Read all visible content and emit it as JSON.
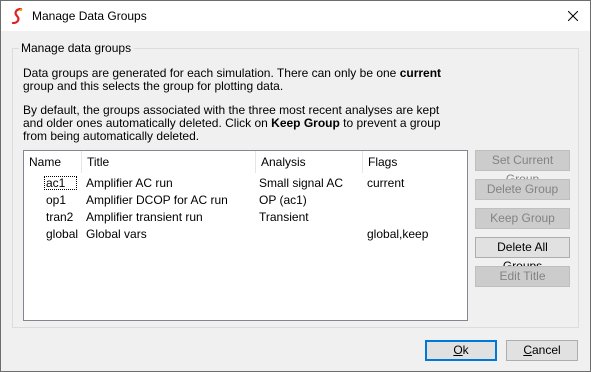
{
  "window": {
    "title": "Manage Data Groups",
    "app_icon": "simetrix-logo-icon",
    "close_icon": "close-icon"
  },
  "group": {
    "legend": "Manage data groups",
    "para1": {
      "line1_a": "Data groups are generated for each simulation. There can only be one ",
      "line1_b": "current",
      "line2": "group and this selects the group for plotting data."
    },
    "para2": {
      "line1": "By default, the groups associated with the three most recent analyses are kept",
      "line2_a": "and older ones automatically deleted. Click on ",
      "line2_b": "Keep Group",
      "line2_c": " to prevent a group",
      "line3": "from being automatically deleted."
    }
  },
  "list": {
    "columns": [
      "Name",
      "Title",
      "Analysis",
      "Flags"
    ],
    "rows": [
      {
        "name": "ac1",
        "title": "Amplifier AC run",
        "analysis": "Small signal AC",
        "flags": "current"
      },
      {
        "name": "op1",
        "title": "Amplifier DCOP for AC run",
        "analysis": "OP (ac1)",
        "flags": ""
      },
      {
        "name": "tran2",
        "title": "Amplifier transient run",
        "analysis": "Transient",
        "flags": ""
      },
      {
        "name": "global",
        "title": "Global vars",
        "analysis": "",
        "flags": "global,keep"
      }
    ]
  },
  "side_buttons": {
    "set_current": "Set Current Group",
    "delete": "Delete Group",
    "keep": "Keep Group",
    "delete_all": "Delete All Groups",
    "edit_title": "Edit Title"
  },
  "dialog_buttons": {
    "ok": "Ok",
    "cancel": "Cancel"
  },
  "colors": {
    "accent": "#0078d7",
    "icon_red": "#e02020"
  }
}
